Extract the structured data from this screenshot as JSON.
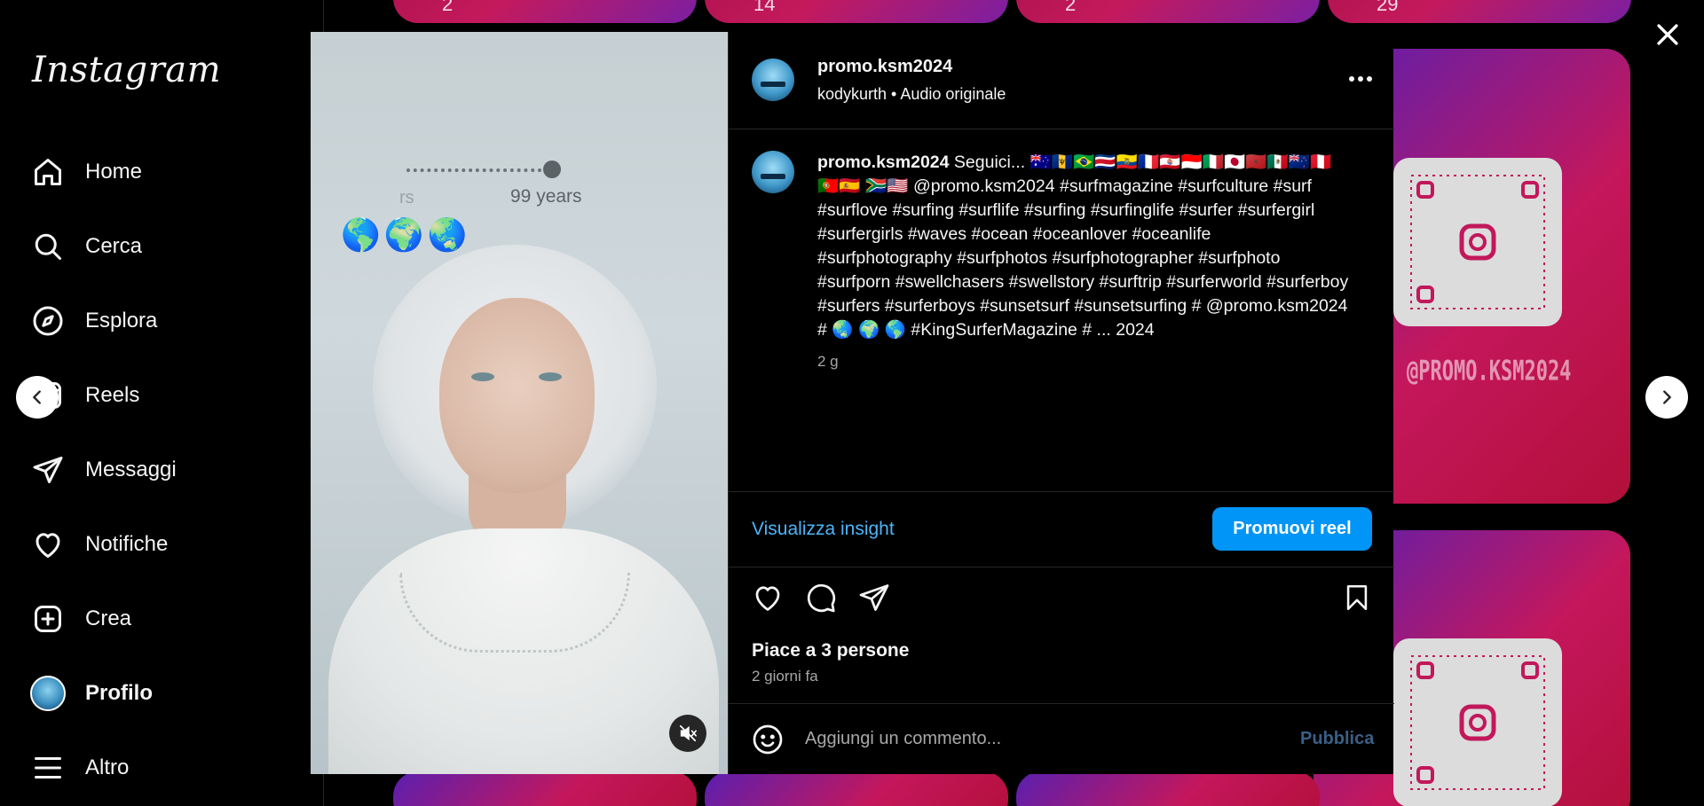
{
  "sidebar": {
    "logo": "Instagram",
    "items": [
      {
        "label": "Home",
        "icon": "home-icon"
      },
      {
        "label": "Cerca",
        "icon": "search-icon"
      },
      {
        "label": "Esplora",
        "icon": "compass-icon"
      },
      {
        "label": "Reels",
        "icon": "reels-icon"
      },
      {
        "label": "Messaggi",
        "icon": "send-icon"
      },
      {
        "label": "Notifiche",
        "icon": "heart-icon"
      },
      {
        "label": "Crea",
        "icon": "plus-square-icon"
      },
      {
        "label": "Profilo",
        "icon": "avatar"
      },
      {
        "label": "Altro",
        "icon": "menu-icon"
      }
    ]
  },
  "background_grid": {
    "counts": [
      "2",
      "14",
      "2",
      "29"
    ],
    "qr_handle": "@PROMO.KSM2024"
  },
  "media": {
    "years_left": "rs",
    "years_right": "99 years",
    "globes": "🌎🌍🌏"
  },
  "post": {
    "username": "promo.ksm2024",
    "subtitle": "kodykurth • Audio originale",
    "caption_user": "promo.ksm2024",
    "caption_text": " Seguici... 🇦🇺🇧🇧🇧🇷🇨🇷🇪🇨🇫🇷🇵🇫🇮🇩🇮🇹🇯🇵🇲🇦🇲🇽🇳🇿🇵🇪🇵🇹🇪🇸 🇿🇦🇺🇸 @promo.ksm2024 #surfmagazine #surfculture #surf #surflove #surfing #surflife #surfing #surfinglife #surfer #surfergirl #surfergirls #waves #ocean #oceanlover #oceanlife #surfphotography #surfphotos #surfphotographer #surfphoto #surfporn #swellchasers #swellstory #surftrip #surferworld #surferboy #surfers #surferboys #sunsetsurf #sunsetsurfing # @promo.ksm2024 # 🌏 🌍 🌎 #KingSurferMagazine # ... 2024",
    "caption_time": "2 g",
    "insights_link": "Visualizza insight",
    "promote_button": "Promuovi reel",
    "likes": "Piace a 3 persone",
    "date": "2 giorni fa",
    "comment_placeholder": "Aggiungi un commento...",
    "publish": "Pubblica"
  },
  "colors": {
    "accent_blue": "#0095f6",
    "link_blue": "#4cb5f9",
    "background": "#000000",
    "border": "#262626"
  }
}
